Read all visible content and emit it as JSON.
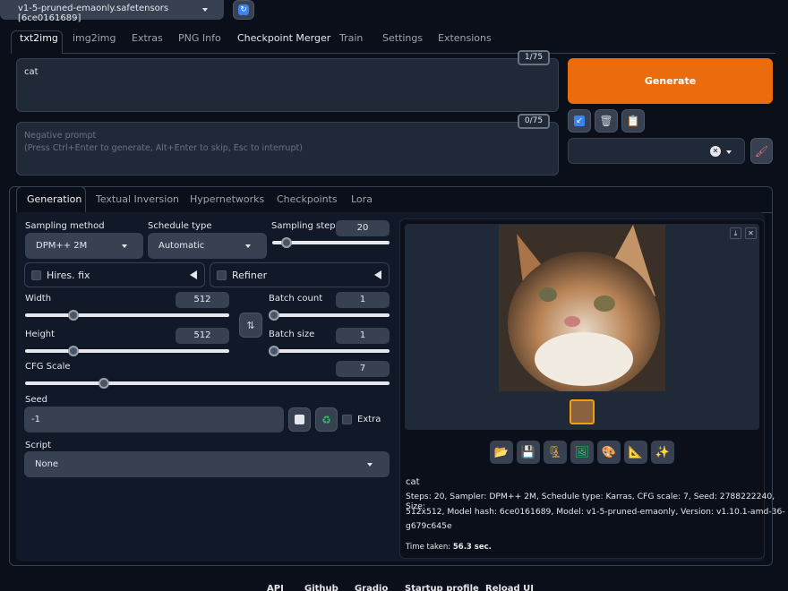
{
  "model_select": {
    "value": "v1-5-pruned-emaonly.safetensors [6ce0161689]"
  },
  "tabs": [
    "txt2img",
    "img2img",
    "Extras",
    "PNG Info",
    "Checkpoint Merger",
    "Train",
    "Settings",
    "Extensions"
  ],
  "prompt": {
    "value": "cat",
    "token_count": "1/75"
  },
  "negative_prompt": {
    "placeholder_line1": "Negative prompt",
    "placeholder_line2": "(Press Ctrl+Enter to generate, Alt+Enter to skip, Esc to interrupt)",
    "token_count": "0/75"
  },
  "generate_label": "Generate",
  "subtabs": [
    "Generation",
    "Textual Inversion",
    "Hypernetworks",
    "Checkpoints",
    "Lora"
  ],
  "params": {
    "sampling_method_label": "Sampling method",
    "sampling_method": "DPM++ 2M",
    "schedule_type_label": "Schedule type",
    "schedule_type": "Automatic",
    "sampling_steps_label": "Sampling steps",
    "sampling_steps": "20",
    "hires_fix": "Hires. fix",
    "refiner": "Refiner",
    "width_label": "Width",
    "width": "512",
    "height_label": "Height",
    "height": "512",
    "batch_count_label": "Batch count",
    "batch_count": "1",
    "batch_size_label": "Batch size",
    "batch_size": "1",
    "cfg_label": "CFG Scale",
    "cfg": "7",
    "seed_label": "Seed",
    "seed": "-1",
    "extra_label": "Extra",
    "script_label": "Script",
    "script": "None"
  },
  "output": {
    "caption": "cat",
    "info_line1": "Steps: 20, Sampler: DPM++ 2M, Schedule type: Karras, CFG scale: 7, Seed: 2788222240, Size:",
    "info_line2": "512x512, Model hash: 6ce0161689, Model: v1-5-pruned-emaonly, Version: v1.10.1-amd-36-",
    "info_line3": "g679c645e",
    "time_label": "Time taken:",
    "time_value": "56.3 sec."
  },
  "footer": [
    "API",
    "Github",
    "Gradio",
    "Startup profile",
    "Reload UI"
  ]
}
